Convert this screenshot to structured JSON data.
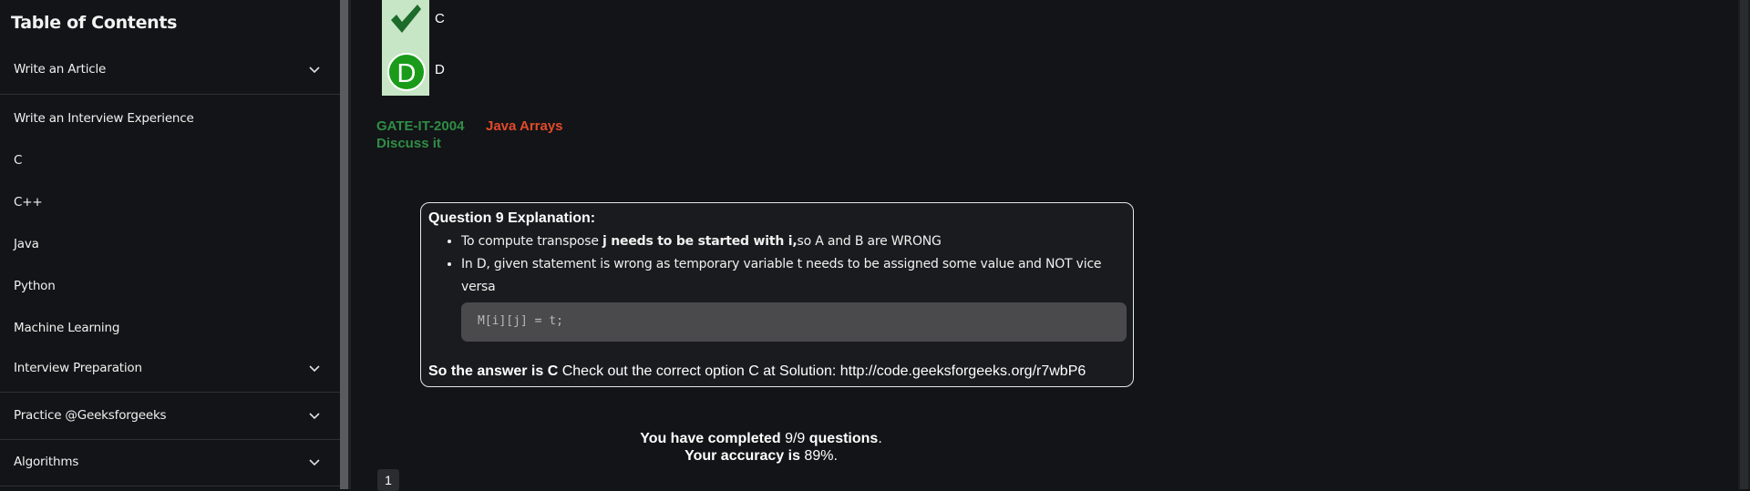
{
  "sidebar": {
    "title": "Table of Contents",
    "items": [
      {
        "label": "Write an Article",
        "expandable": true
      },
      {
        "label": "Write an Interview Experience",
        "expandable": false
      },
      {
        "label": "C",
        "expandable": false
      },
      {
        "label": "C++",
        "expandable": false
      },
      {
        "label": "Java",
        "expandable": false
      },
      {
        "label": "Python",
        "expandable": false
      },
      {
        "label": "Machine Learning",
        "expandable": false
      },
      {
        "label": "Interview Preparation",
        "expandable": true
      },
      {
        "label": "Practice @Geeksforgeeks",
        "expandable": true
      },
      {
        "label": "Algorithms",
        "expandable": true
      }
    ]
  },
  "quiz": {
    "options": [
      {
        "label": "C",
        "icon": "checkmark-icon"
      },
      {
        "label": "D",
        "icon": "letter-d-icon",
        "letter": "D"
      }
    ],
    "tags": {
      "exam": "GATE-IT-2004",
      "topic": "Java Arrays",
      "discuss": "Discuss it"
    },
    "explanation": {
      "title": "Question 9 Explanation:",
      "bullet1_prefix": "To compute transpose ",
      "bullet1_bold": "j needs to be started with i,",
      "bullet1_suffix": "so A and B are WRONG",
      "bullet2": "In D, given statement is wrong as temporary variable t needs to be assigned some value and NOT vice versa",
      "code": "M[i][j] = t;",
      "answer_bold": "So the answer is C",
      "answer_rest": " Check out the correct option C at Solution: http://code.geeksforgeeks.org/r7wbP6"
    },
    "summary": {
      "completed_prefix": "You have completed ",
      "completed_value": "9/9",
      "completed_suffix": " questions",
      "completed_dot": ".",
      "accuracy_prefix": "Your accuracy is ",
      "accuracy_value": "89%",
      "accuracy_dot": "."
    },
    "pagination": {
      "current": "1"
    }
  },
  "colors": {
    "background": "#131417",
    "accent_green": "#2f8d46",
    "accent_orange": "#e24a2a",
    "option_bar": "#c6e6c6",
    "correct_green": "#1a9c1a"
  }
}
